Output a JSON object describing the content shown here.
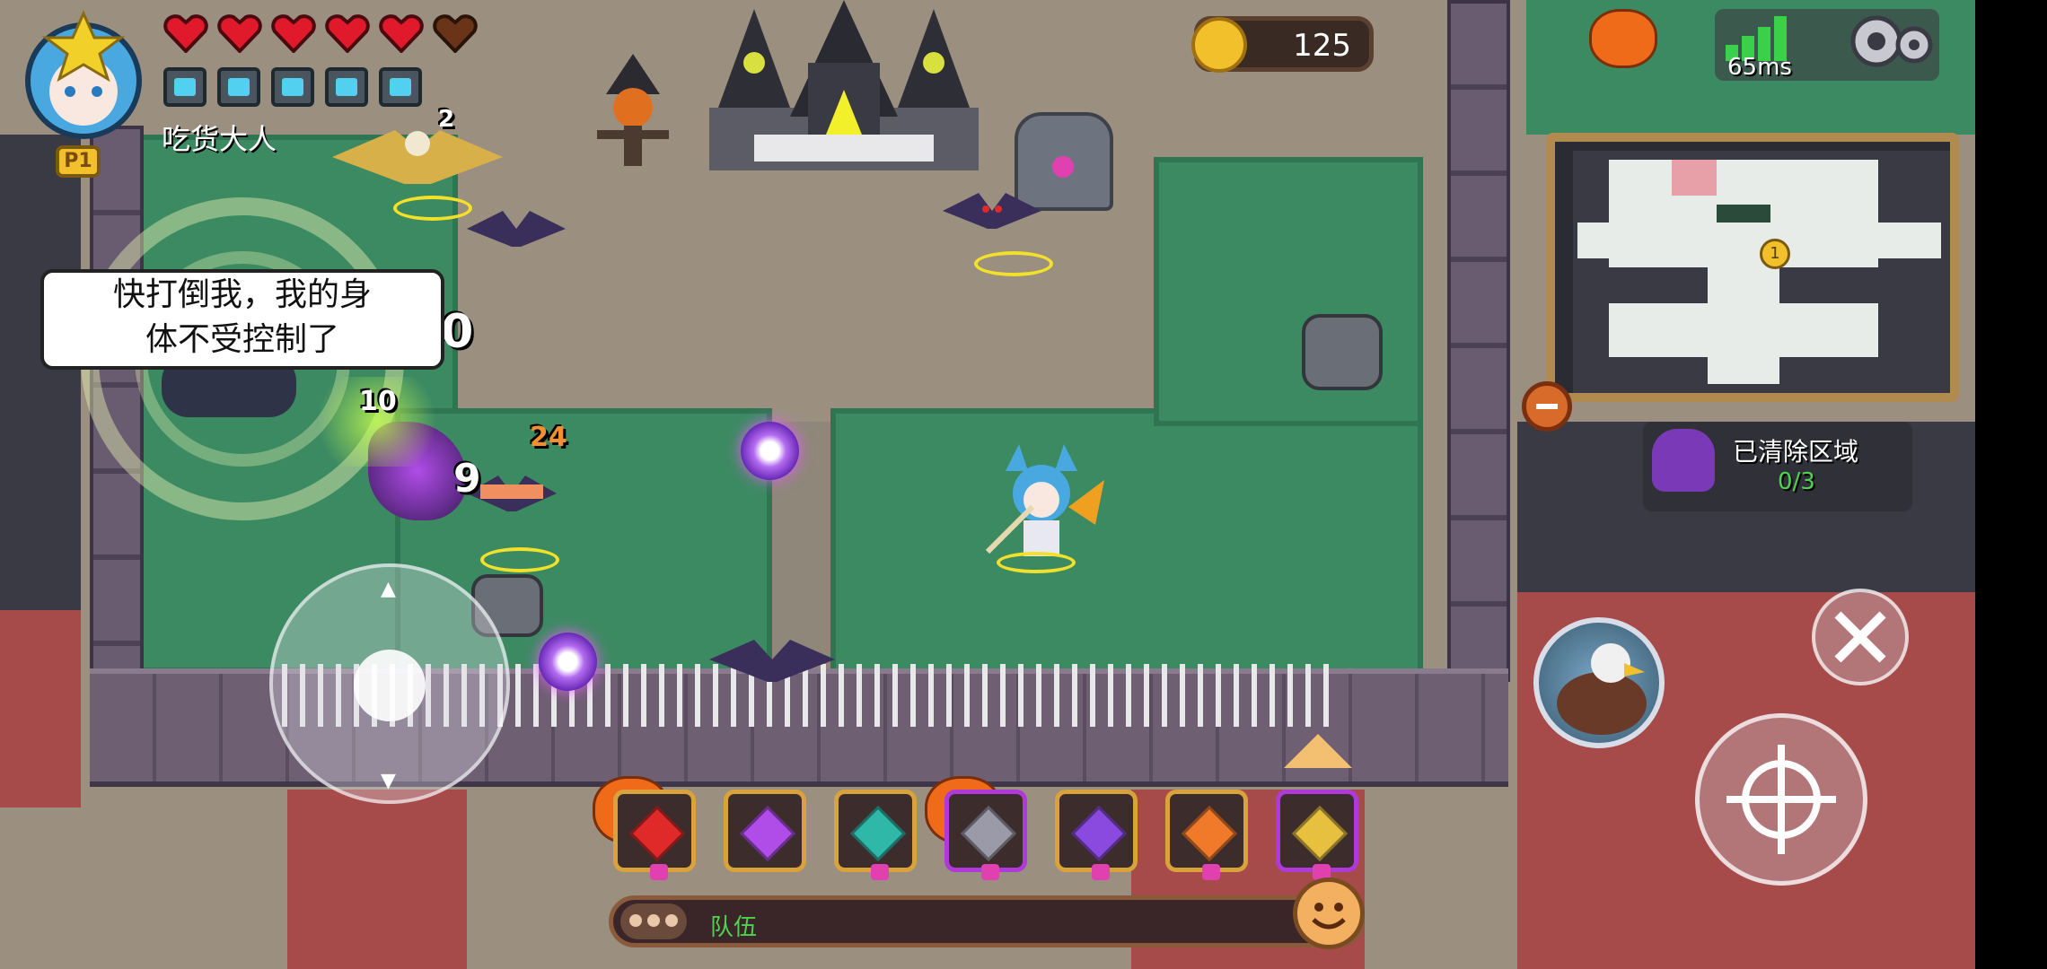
{
  "player": {
    "name": "吃货大人",
    "tag": "P1",
    "hearts_full": 5,
    "hearts_total": 6,
    "shields_full": 5
  },
  "coins": {
    "value": "125"
  },
  "network": {
    "ping": "65ms"
  },
  "minimap": {
    "marker": "1"
  },
  "objective": {
    "label": "已清除区域",
    "progress": "0/3"
  },
  "speech": {
    "line1": "快打倒我，我的身",
    "line2": "体不受控制了"
  },
  "damage_numbers": [
    "10",
    "10",
    "24",
    "9",
    "2"
  ],
  "team_chat": {
    "label": "队伍"
  },
  "skills": [
    {
      "icon": "red-crystal-icon",
      "color": "#e02a2a"
    },
    {
      "icon": "purple-star-crystal-icon",
      "color": "#b04de8"
    },
    {
      "icon": "teal-crystal-icon",
      "color": "#2fb8a8"
    },
    {
      "icon": "turret-icon",
      "color": "#9a9aa8"
    },
    {
      "icon": "purple-gem-icon",
      "color": "#8a4ae0"
    },
    {
      "icon": "orange-star-icon",
      "color": "#f07a2a"
    },
    {
      "icon": "gold-lantern-icon",
      "color": "#e8c040"
    }
  ],
  "colors": {
    "grass": "#3c8a62",
    "coin_text": "#ffffff",
    "objective_progress": "#4fd24f",
    "team_label": "#4fd24f"
  }
}
